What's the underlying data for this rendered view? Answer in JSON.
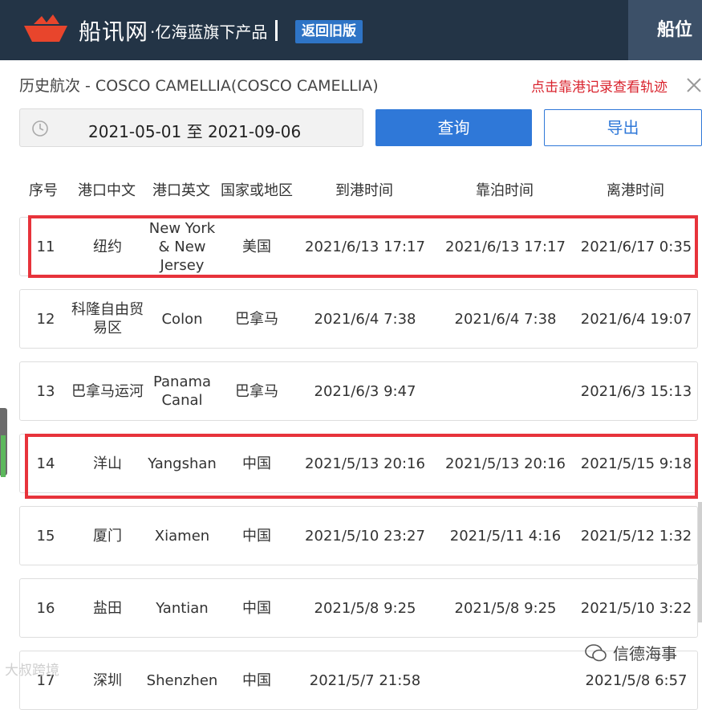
{
  "header": {
    "brand_name": "船讯网",
    "brand_sub": "·亿海蓝旗下产品",
    "back_button": "返回旧版",
    "right_tab": "船位"
  },
  "page": {
    "title": "历史航次 - COSCO CAMELLIA(COSCO CAMELLIA)",
    "track_hint": "点击靠港记录查看轨迹"
  },
  "controls": {
    "date_range": "2021-05-01 至 2021-09-06",
    "query_button": "查询",
    "export_button": "导出"
  },
  "table": {
    "headers": [
      "序号",
      "港口中文",
      "港口英文",
      "国家或地区",
      "到港时间",
      "靠泊时间",
      "离港时间"
    ],
    "rows": [
      [
        "11",
        "纽约",
        "New York & New Jersey",
        "美国",
        "2021/6/13 17:17",
        "2021/6/13 17:17",
        "2021/6/17 0:35"
      ],
      [
        "12",
        "科隆自由贸易区",
        "Colon",
        "巴拿马",
        "2021/6/4 7:38",
        "2021/6/4 7:38",
        "2021/6/4 19:07"
      ],
      [
        "13",
        "巴拿马运河",
        "Panama Canal",
        "巴拿马",
        "2021/6/3 9:47",
        "",
        "2021/6/3 15:13"
      ],
      [
        "14",
        "洋山",
        "Yangshan",
        "中国",
        "2021/5/13 20:16",
        "2021/5/13 20:16",
        "2021/5/15 9:18"
      ],
      [
        "15",
        "厦门",
        "Xiamen",
        "中国",
        "2021/5/10 23:27",
        "2021/5/11 4:16",
        "2021/5/12 1:32"
      ],
      [
        "16",
        "盐田",
        "Yantian",
        "中国",
        "2021/5/8 9:25",
        "2021/5/8 9:25",
        "2021/5/10 3:22"
      ],
      [
        "17",
        "深圳",
        "Shenzhen",
        "中国",
        "2021/5/7 21:58",
        "",
        "2021/5/8 6:57"
      ]
    ]
  },
  "watermarks": {
    "left": "大叔跨境",
    "right": "信德海事"
  },
  "colors": {
    "header_bg": "#233446",
    "accent_blue": "#2f78d8",
    "highlight_red": "#e7333b",
    "hint_red": "#d9232d"
  }
}
